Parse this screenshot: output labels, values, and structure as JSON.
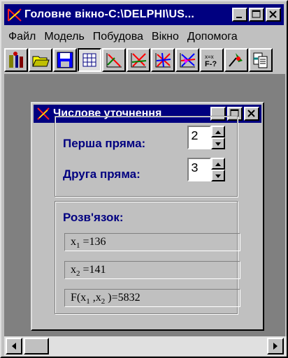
{
  "main_window": {
    "title": "Головне вікно-C:\\DELPHI\\US...",
    "controls": [
      "minimize-icon",
      "maximize-icon",
      "close-icon"
    ]
  },
  "menu": [
    {
      "label": "Файл"
    },
    {
      "label": "Модель"
    },
    {
      "label": "Побудова"
    },
    {
      "label": "Вікно"
    },
    {
      "label": "Допомога"
    }
  ],
  "toolbar": {
    "icons": [
      "tool-figure-icon",
      "open-folder-icon",
      "save-disk-icon",
      "grid-table-icon",
      "line-plot-icon",
      "lines-cross-icon",
      "lines-multiple-icon",
      "lines-region-icon",
      "formula-icon",
      "solution-point-icon",
      "copy-document-icon"
    ]
  },
  "child_window": {
    "title": "Числове уточнення",
    "first_line_label": "Перша пряма:",
    "first_line_value": "2",
    "second_line_label": "Друга  пряма:",
    "second_line_value": "3",
    "solution_label": "Розв'язок:",
    "results": {
      "x1": {
        "var": "x",
        "sub": "1",
        "rest": " =136"
      },
      "x2": {
        "var": "x",
        "sub": "2",
        "rest": " =141"
      },
      "f": {
        "prefix": "F(x",
        "sub1": "1",
        "mid": " ,x",
        "sub2": "2",
        "rest": " )=5832"
      }
    }
  },
  "colors": {
    "title_bar": "#000080",
    "face": "#c0c0c0",
    "workspace": "#808080",
    "label_text": "#000080"
  }
}
